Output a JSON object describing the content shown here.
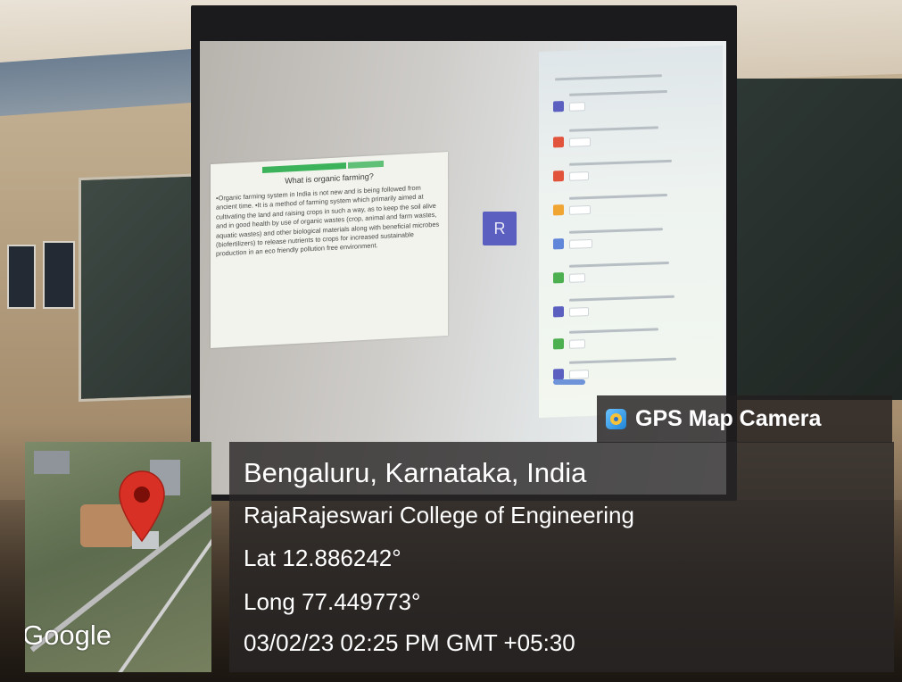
{
  "gps_overlay": {
    "app_icon": "gps-map-camera-icon",
    "app_name": "GPS Map Camera",
    "location": "Bengaluru, Karnataka, India",
    "place": "RajaRajeswari College of Engineering",
    "latitude": "Lat 12.886242°",
    "longitude": "Long 77.449773°",
    "datetime": "03/02/23 02:25 PM GMT +05:30",
    "map_attribution": "Google",
    "map_marker_icon": "map-pin-icon"
  },
  "projected_slide": {
    "title": "What is organic farming?",
    "body": "•Organic farming system in India is not new and is being followed from ancient time. •It is a method of farming system which primarily aimed at cultivating the land and raising crops in such a way, as to keep the soil alive and in good health by use of organic wastes (crop, animal and farm wastes, aquatic wastes) and other biological materials along with beneficial microbes (biofertilizers) to release nutrients to crops for increased sustainable production in an eco friendly pollution free environment."
  },
  "meeting_panel": {
    "participant_initial": "R"
  },
  "colors": {
    "overlay_bg": "#28262580",
    "pin_red": "#d93025",
    "avatar_purple": "#5a5fc0",
    "slide_header_green": "#3cb35a"
  }
}
